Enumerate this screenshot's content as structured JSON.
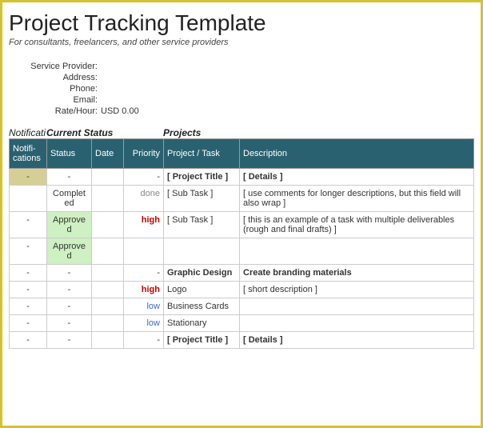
{
  "header": {
    "title": "Project Tracking Template",
    "subtitle": "For consultants, freelancers, and other service providers"
  },
  "info": {
    "labels": {
      "provider": "Service Provider:",
      "address": "Address:",
      "phone": "Phone:",
      "email": "Email:",
      "rate": "Rate/Hour:"
    },
    "values": {
      "provider": "",
      "address": "",
      "phone": "",
      "email": "",
      "rate": "USD 0.00"
    }
  },
  "group_headers": {
    "notif": "Notificati",
    "status": "Current Status",
    "projects": "Projects"
  },
  "columns": {
    "notif": "Notifi-cations",
    "status": "Status",
    "date": "Date",
    "priority": "Priority",
    "task": "Project / Task",
    "desc": "Description"
  },
  "rows": [
    {
      "notif": "-",
      "status": "-",
      "date": "",
      "priority": "-",
      "priority_class": "right",
      "task": "[ Project Title ]",
      "desc": "[ Details ]",
      "bold": true,
      "notif_bg": true
    },
    {
      "notif": "",
      "status": "Completed",
      "date": "",
      "priority": "done",
      "priority_class": "priority-done",
      "task": "[ Sub Task ]",
      "desc": "[ use comments for longer descriptions, but this field will also wrap ]"
    },
    {
      "notif": "-",
      "status": "Approved",
      "status_class": "approved",
      "date": "",
      "priority": "high",
      "priority_class": "priority-high",
      "task": "[ Sub Task ]",
      "desc": "[ this is an example of a task with multiple deliverables (rough and final drafts) ]"
    },
    {
      "notif": "-",
      "status": "Approved",
      "status_class": "approved",
      "date": "",
      "priority": "",
      "task": "",
      "desc": ""
    },
    {
      "notif": "-",
      "status": "-",
      "date": "",
      "priority": "-",
      "priority_class": "right",
      "task": "Graphic Design",
      "desc": "Create branding materials",
      "bold": true
    },
    {
      "notif": "-",
      "status": "-",
      "date": "",
      "priority": "high",
      "priority_class": "priority-high",
      "task": "Logo",
      "desc": "[ short description ]"
    },
    {
      "notif": "-",
      "status": "-",
      "date": "",
      "priority": "low",
      "priority_class": "priority-low",
      "task": "Business Cards",
      "desc": ""
    },
    {
      "notif": "-",
      "status": "-",
      "date": "",
      "priority": "low",
      "priority_class": "priority-low",
      "task": "Stationary",
      "desc": ""
    },
    {
      "notif": "-",
      "status": "-",
      "date": "",
      "priority": "-",
      "priority_class": "right",
      "task": "[ Project Title ]",
      "desc": "[ Details ]",
      "bold": true
    }
  ]
}
